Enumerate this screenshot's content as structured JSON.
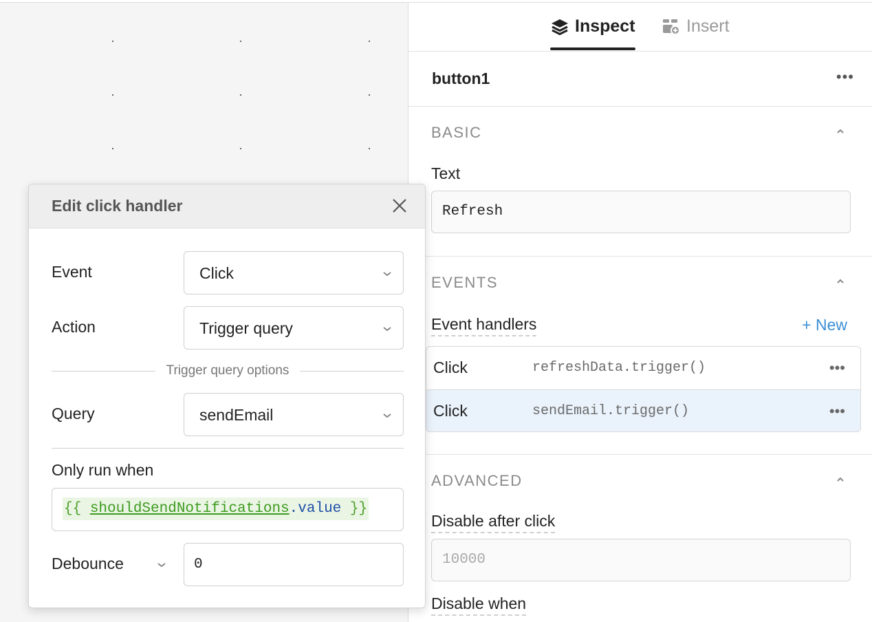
{
  "tabs": {
    "inspect_label": "Inspect",
    "insert_label": "Insert"
  },
  "component": {
    "name": "button1"
  },
  "basic": {
    "title": "BASIC",
    "text_label": "Text",
    "text_value": "Refresh"
  },
  "events": {
    "title": "EVENTS",
    "handlers_label": "Event handlers",
    "new_label": "+ New",
    "handlers": [
      {
        "event": "Click",
        "code": "refreshData.trigger()"
      },
      {
        "event": "Click",
        "code": "sendEmail.trigger()"
      }
    ]
  },
  "advanced": {
    "title": "ADVANCED",
    "disable_after_label": "Disable after click",
    "disable_after_placeholder": "10000",
    "disable_when_label": "Disable when"
  },
  "modal": {
    "title": "Edit click handler",
    "event_label": "Event",
    "event_value": "Click",
    "action_label": "Action",
    "action_value": "Trigger query",
    "options_divider": "Trigger query options",
    "query_label": "Query",
    "query_value": "sendEmail",
    "only_run_label": "Only run when",
    "code_open": "{{ ",
    "code_var": "shouldSendNotifications",
    "code_prop": ".value",
    "code_close": " }}",
    "debounce_label": "Debounce",
    "debounce_value": "0"
  }
}
